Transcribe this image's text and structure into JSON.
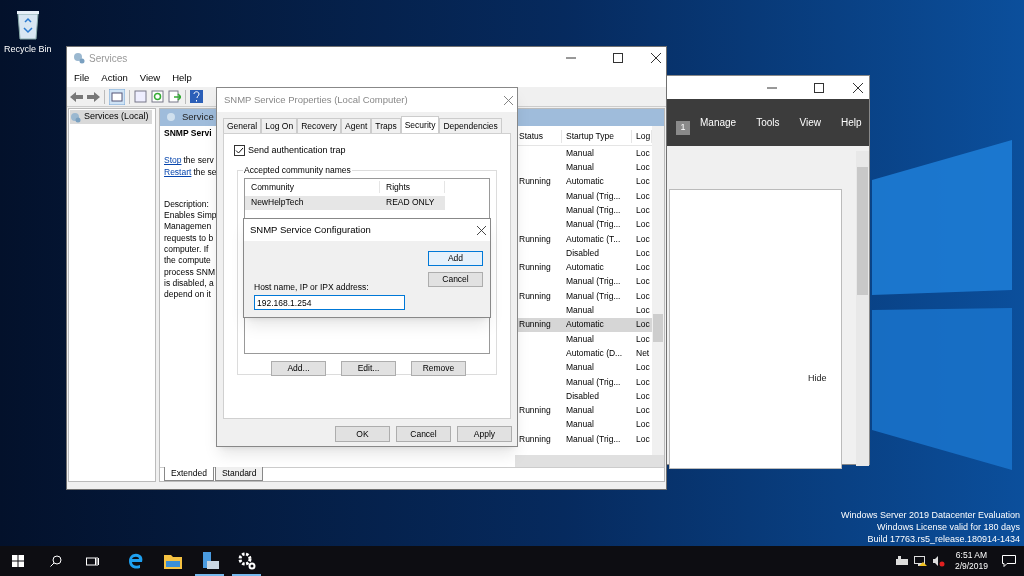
{
  "desktop": {
    "icons": [
      {
        "label": "Recycle Bin"
      }
    ],
    "watermark_lines": [
      "Windows Server 2019 Datacenter Evaluation",
      "Windows License valid for 180 days",
      "Build 17763.rs5_release.180914-1434"
    ]
  },
  "server_manager": {
    "menu": [
      "Manage",
      "Tools",
      "View",
      "Help"
    ],
    "flag_count": "1",
    "hide_link": "Hide"
  },
  "services_window": {
    "title": "Services",
    "menu": [
      "File",
      "Action",
      "View",
      "Help"
    ],
    "tree": [
      {
        "label": "Services (Local)",
        "selected": true
      }
    ],
    "header": "Service",
    "service_name": "SNMP Servi",
    "actions": [
      {
        "link": "Stop",
        "text": "the serv"
      },
      {
        "link": "Restart",
        "text": "the se"
      }
    ],
    "description_lines": [
      "Description:",
      "Enables Simp",
      "Managemen",
      "requests to b",
      "computer. If",
      "the compute",
      "process SNM",
      "is disabled, a",
      "depend on it"
    ],
    "columns": [
      "Status",
      "Startup Type",
      "Log"
    ],
    "rows": [
      {
        "startup": "Manual",
        "log": "Loc",
        "selected": false
      },
      {
        "startup": "Manual",
        "log": "Loc",
        "selected": false
      },
      {
        "status": "Running",
        "startup": "Automatic",
        "log": "Loc",
        "selected": false
      },
      {
        "startup": "Manual (Trig...",
        "log": "Loc",
        "selected": false
      },
      {
        "startup": "Manual (Trig...",
        "log": "Loc",
        "selected": false
      },
      {
        "startup": "Manual (Trig...",
        "log": "Loc",
        "selected": false
      },
      {
        "status": "Running",
        "startup": "Automatic (T...",
        "log": "Loc",
        "selected": false
      },
      {
        "startup": "Disabled",
        "log": "Loc",
        "selected": false
      },
      {
        "status": "Running",
        "startup": "Automatic",
        "log": "Loc",
        "selected": false
      },
      {
        "startup": "Manual (Trig...",
        "log": "Loc",
        "selected": false
      },
      {
        "status": "Running",
        "startup": "Manual (Trig...",
        "log": "Loc",
        "selected": false
      },
      {
        "startup": "Manual",
        "log": "Loc",
        "selected": false
      },
      {
        "status": "Running",
        "startup": "Automatic",
        "log": "Loc",
        "selected": true
      },
      {
        "startup": "Manual",
        "log": "Loc",
        "selected": false
      },
      {
        "startup": "Automatic (D...",
        "log": "Net",
        "selected": false
      },
      {
        "startup": "Manual",
        "log": "Loc",
        "selected": false
      },
      {
        "startup": "Manual (Trig...",
        "log": "Loc",
        "selected": false
      },
      {
        "startup": "Disabled",
        "log": "Loc",
        "selected": false
      },
      {
        "status": "Running",
        "startup": "Manual",
        "log": "Loc",
        "selected": false
      },
      {
        "startup": "Manual",
        "log": "Loc",
        "selected": false
      },
      {
        "status": "Running",
        "startup": "Manual (Trig...",
        "log": "Loc",
        "selected": false
      }
    ],
    "view_tabs": [
      {
        "label": "Extended",
        "selected": true
      },
      {
        "label": "Standard",
        "selected": false
      }
    ]
  },
  "properties_dialog": {
    "title": "SNMP Service Properties (Local Computer)",
    "tabs": [
      {
        "label": "General",
        "selected": false
      },
      {
        "label": "Log On",
        "selected": false
      },
      {
        "label": "Recovery",
        "selected": false
      },
      {
        "label": "Agent",
        "selected": false
      },
      {
        "label": "Traps",
        "selected": false
      },
      {
        "label": "Security",
        "selected": true
      },
      {
        "label": "Dependencies",
        "selected": false
      }
    ],
    "send_auth_trap": {
      "label": "Send authentication trap",
      "checked": true
    },
    "group_label": "Accepted community names",
    "list_columns": [
      "Community",
      "Rights"
    ],
    "communities": [
      {
        "community": "NewHelpTech",
        "rights": "READ ONLY",
        "selected": true
      }
    ],
    "list_buttons": [
      "Add...",
      "Edit...",
      "Remove"
    ],
    "buttons": [
      "OK",
      "Cancel",
      "Apply"
    ]
  },
  "config_dialog": {
    "title": "SNMP Service Configuration",
    "buttons": [
      {
        "label": "Add",
        "default": true
      },
      {
        "label": "Cancel",
        "default": false
      }
    ],
    "field_label": "Host name, IP or IPX address:",
    "field_value": "192.168.1.254"
  },
  "taskbar": {
    "apps": [
      {
        "kind": "browser",
        "running": false
      },
      {
        "kind": "folder",
        "running": false
      },
      {
        "kind": "server",
        "running": true
      },
      {
        "kind": "gear",
        "running": true
      }
    ],
    "time": "6:51 AM",
    "date": "2/9/2019"
  }
}
